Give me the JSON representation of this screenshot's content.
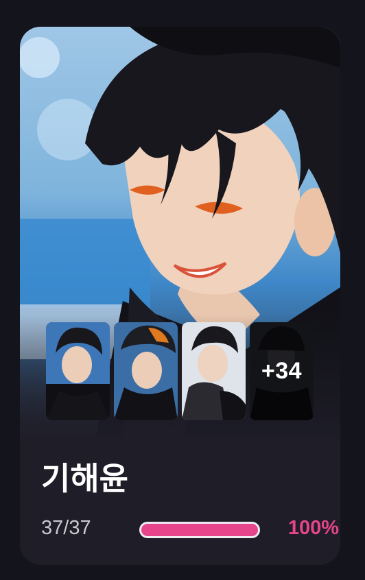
{
  "character": {
    "name": "기해윤",
    "progress_text": "37/37",
    "progress_fraction": 1.0,
    "progress_percent": "100%",
    "more_count": "+34"
  },
  "colors": {
    "background": "#14141d",
    "card": "#1e1d28",
    "accent": "#e6448b",
    "track": "#ededf2"
  }
}
